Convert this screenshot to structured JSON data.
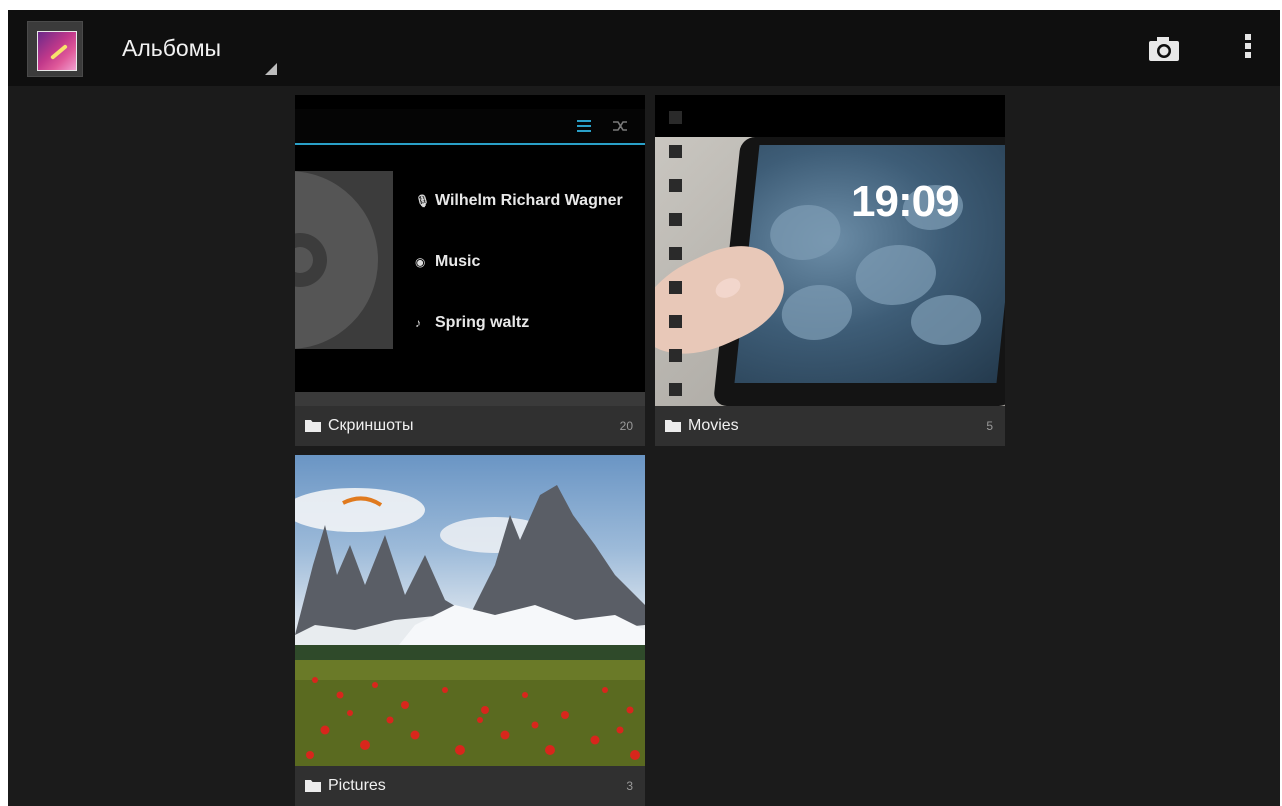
{
  "actionbar": {
    "title": "Альбомы",
    "app_icon": "gallery-icon",
    "actions": [
      {
        "name": "camera-icon"
      },
      {
        "name": "overflow-menu-icon"
      }
    ]
  },
  "albums": [
    {
      "label": "Скриншоты",
      "count": "20",
      "thumbnail": {
        "rows": [
          {
            "icon": "microphone-icon",
            "text": "Wilhelm Richard Wagner"
          },
          {
            "icon": "album-icon",
            "text": "Music"
          },
          {
            "icon": "music-note-icon",
            "text": "Spring waltz"
          }
        ]
      }
    },
    {
      "label": "Movies",
      "count": "5",
      "thumbnail": {
        "clock_text": "19:09"
      }
    },
    {
      "label": "Pictures",
      "count": "3"
    }
  ],
  "colors": {
    "background": "#1b1b1b",
    "actionbar": "#0f0f0f",
    "caption_bar": "#343434",
    "accent": "#2aa0c8"
  }
}
